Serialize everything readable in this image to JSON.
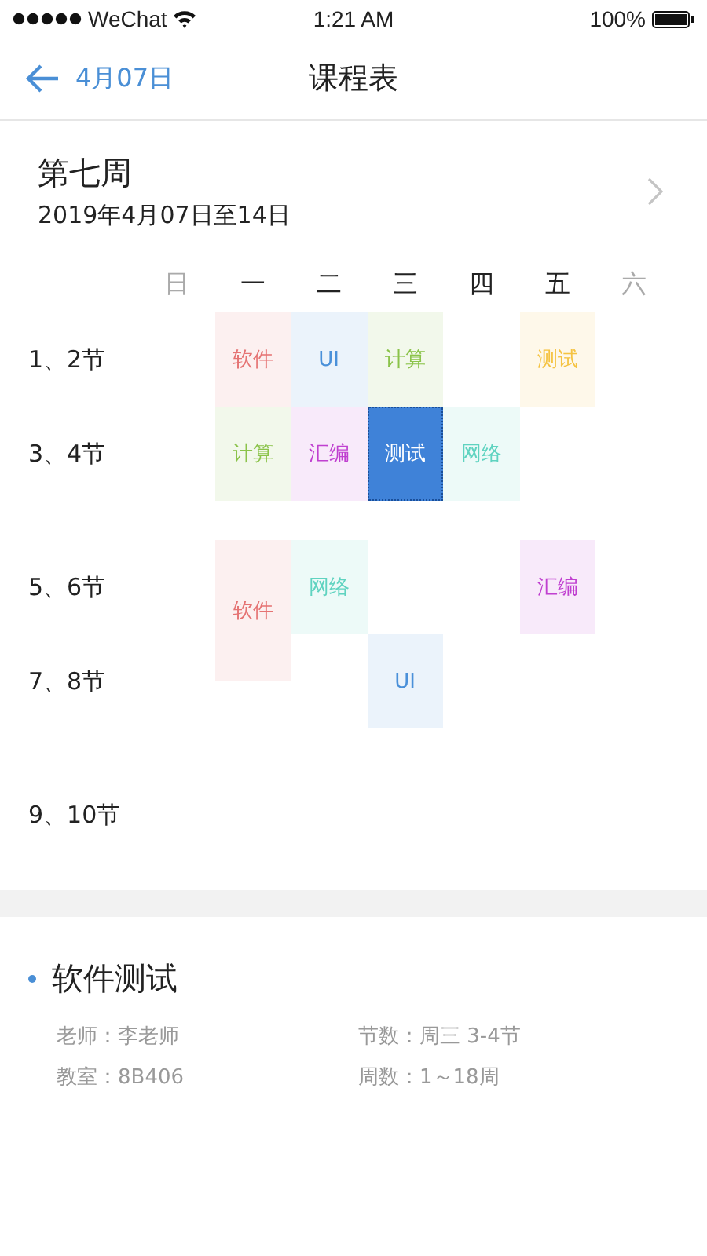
{
  "status_bar": {
    "carrier": "WeChat",
    "time": "1:21 AM",
    "battery": "100%"
  },
  "nav": {
    "back_label": "4月07日",
    "title": "课程表"
  },
  "week": {
    "title": "第七周",
    "range": "2019年4月07日至14日"
  },
  "days": [
    {
      "label": "日",
      "weekend": true
    },
    {
      "label": "一",
      "weekend": false
    },
    {
      "label": "二",
      "weekend": false
    },
    {
      "label": "三",
      "weekend": false
    },
    {
      "label": "四",
      "weekend": false
    },
    {
      "label": "五",
      "weekend": false
    },
    {
      "label": "六",
      "weekend": true
    }
  ],
  "slots": [
    {
      "label": "1、2节",
      "cells": [
        {
          "kind": "empty"
        },
        {
          "kind": "course",
          "name": "软件",
          "color": "#e57373",
          "selected": false
        },
        {
          "kind": "course",
          "name": "UI",
          "color": "#4a90d9",
          "selected": false
        },
        {
          "kind": "course",
          "name": "计算",
          "color": "#8bc34a",
          "selected": false
        },
        {
          "kind": "empty"
        },
        {
          "kind": "course",
          "name": "测试",
          "color": "#f5c342",
          "selected": false
        },
        {
          "kind": "empty"
        }
      ]
    },
    {
      "label": "3、4节",
      "cells": [
        {
          "kind": "empty"
        },
        {
          "kind": "course",
          "name": "计算",
          "color": "#8bc34a",
          "selected": false
        },
        {
          "kind": "course",
          "name": "汇编",
          "color": "#c040d0",
          "selected": false
        },
        {
          "kind": "course",
          "name": "测试",
          "color": "#3f82d8",
          "selected": true
        },
        {
          "kind": "course",
          "name": "网络",
          "color": "#5fd3c0",
          "selected": false
        },
        {
          "kind": "empty"
        },
        {
          "kind": "empty"
        }
      ]
    },
    {
      "label": "5、6节",
      "cells": [
        {
          "kind": "empty"
        },
        {
          "kind": "course_tall",
          "name": "软件",
          "color": "#e57373",
          "selected": false
        },
        {
          "kind": "course",
          "name": "网络",
          "color": "#5fd3c0",
          "selected": false
        },
        {
          "kind": "empty"
        },
        {
          "kind": "empty"
        },
        {
          "kind": "course",
          "name": "汇编",
          "color": "#c040d0",
          "selected": false
        },
        {
          "kind": "empty"
        }
      ]
    },
    {
      "label": "7、8节",
      "cells": [
        {
          "kind": "empty"
        },
        {
          "kind": "empty"
        },
        {
          "kind": "empty"
        },
        {
          "kind": "course",
          "name": "UI",
          "color": "#4a90d9",
          "selected": false
        },
        {
          "kind": "empty"
        },
        {
          "kind": "empty"
        },
        {
          "kind": "empty"
        }
      ]
    },
    {
      "label": "9、10节",
      "cells": [
        {
          "kind": "empty"
        },
        {
          "kind": "empty"
        },
        {
          "kind": "empty"
        },
        {
          "kind": "empty"
        },
        {
          "kind": "empty"
        },
        {
          "kind": "empty"
        },
        {
          "kind": "empty"
        }
      ]
    }
  ],
  "detail": {
    "title": "软件测试",
    "fields": [
      "老师：李老师",
      "节数：周三 3-4节",
      "教室：8B406",
      "周数：1～18周"
    ]
  }
}
